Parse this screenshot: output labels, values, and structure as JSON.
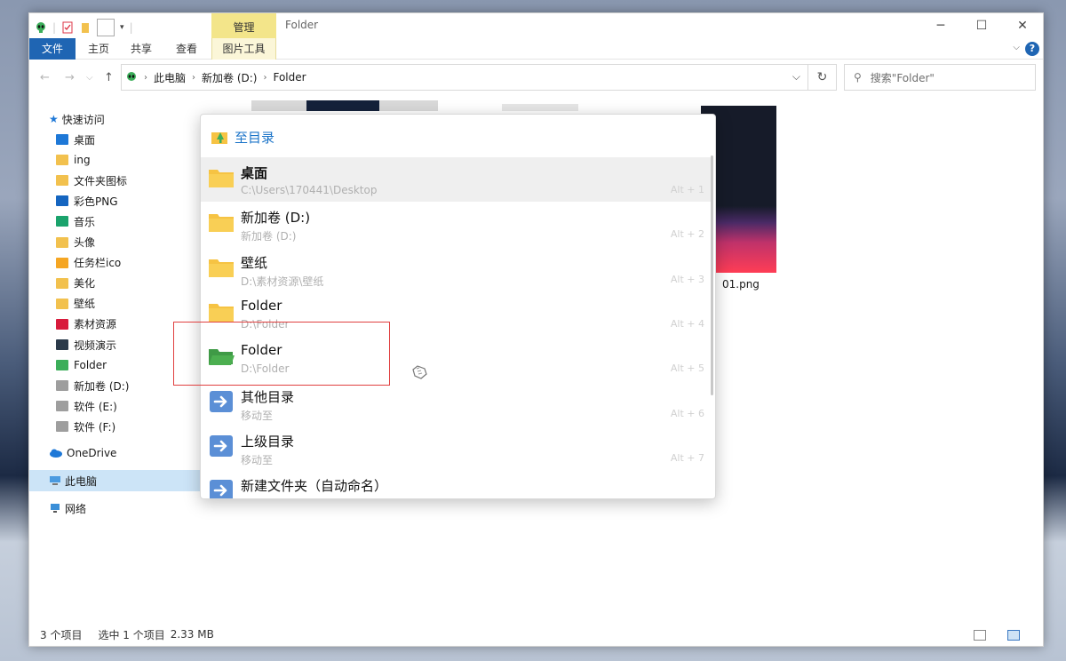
{
  "window": {
    "title": "Folder",
    "context_tab": "管理",
    "controls": {
      "minimize": "─",
      "maximize": "☐",
      "close": "✕"
    }
  },
  "ribbon": {
    "tabs": [
      "文件",
      "主页",
      "共享",
      "查看",
      "图片工具"
    ],
    "expand": "⌵",
    "help": "?"
  },
  "address": {
    "back": "←",
    "forward": "→",
    "recent": "⌵",
    "up": "↑",
    "crumbs": [
      "此电脑",
      "新加卷 (D:)",
      "Folder"
    ],
    "crumb_sep": "›",
    "dropdown": "⌵",
    "refresh": "↻",
    "search_placeholder": "搜索\"Folder\""
  },
  "sidebar": {
    "quick_access": "快速访问",
    "items": [
      {
        "label": "桌面",
        "color": "#1e78d7"
      },
      {
        "label": "ing",
        "color": "#f2c14e"
      },
      {
        "label": "文件夹图标",
        "color": "#f2c14e"
      },
      {
        "label": "彩色PNG",
        "color": "#1565c0"
      },
      {
        "label": "音乐",
        "color": "#1aa36c"
      },
      {
        "label": "头像",
        "color": "#f2c14e"
      },
      {
        "label": "任务栏ico",
        "color": "#f5a623"
      },
      {
        "label": "美化",
        "color": "#f2c14e"
      },
      {
        "label": "壁纸",
        "color": "#f2c14e"
      },
      {
        "label": "素材资源",
        "color": "#d81b3c"
      },
      {
        "label": "视频演示",
        "color": "#2b3a4a"
      },
      {
        "label": "Folder",
        "color": "#3cae5a"
      },
      {
        "label": "新加卷 (D:)",
        "color": "#9e9e9e"
      },
      {
        "label": "软件 (E:)",
        "color": "#9e9e9e"
      },
      {
        "label": "软件 (F:)",
        "color": "#9e9e9e"
      }
    ],
    "onedrive": "OneDrive",
    "this_pc": "此电脑",
    "network": "网络"
  },
  "content": {
    "file_label": "01.png"
  },
  "status": {
    "count": "3 个项目",
    "selection": "选中 1 个项目",
    "size": "2.33 MB"
  },
  "popup": {
    "header": "至目录",
    "items": [
      {
        "title": "桌面",
        "path": "C:\\Users\\170441\\Desktop",
        "shortcut": "Alt + 1",
        "icon": "folder-icon",
        "color": "#f6c343"
      },
      {
        "title": "新加卷 (D:)",
        "path": "新加卷 (D:)",
        "shortcut": "Alt + 2",
        "icon": "folder-icon",
        "color": "#f6c343"
      },
      {
        "title": "壁纸",
        "path": "D:\\素材资源\\壁纸",
        "shortcut": "Alt + 3",
        "icon": "folder-icon",
        "color": "#f6c343"
      },
      {
        "title": "Folder",
        "path": "D:\\Folder",
        "shortcut": "Alt + 4",
        "icon": "folder-icon",
        "color": "#f6c343"
      },
      {
        "title": "Folder",
        "path": "D:\\Folder",
        "shortcut": "Alt + 5",
        "icon": "open-folder-icon",
        "color": "#4caf50"
      },
      {
        "title": "其他目录",
        "path": "移动至",
        "shortcut": "Alt + 6",
        "icon": "arrow-right-icon",
        "color": "#5b8fd6"
      },
      {
        "title": "上级目录",
        "path": "移动至",
        "shortcut": "Alt + 7",
        "icon": "arrow-right-icon",
        "color": "#5b8fd6"
      },
      {
        "title": "新建文件夹（自动命名）",
        "path": "",
        "shortcut": "",
        "icon": "arrow-right-icon",
        "color": "#5b8fd6"
      }
    ]
  }
}
